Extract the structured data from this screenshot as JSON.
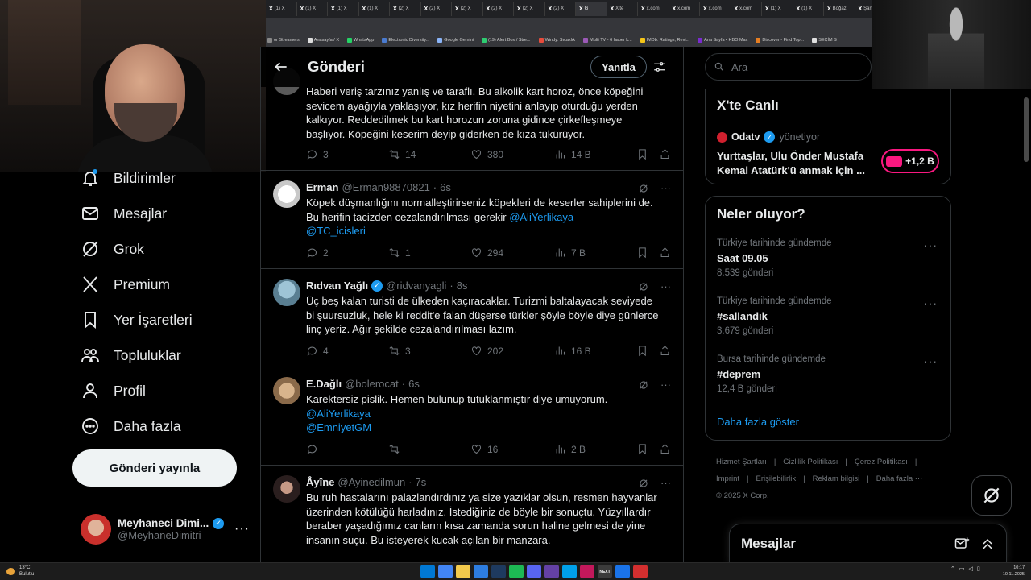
{
  "browser": {
    "tabs": [
      "(1) X",
      "(1) X",
      "(1) X",
      "(1) X",
      "(2) X",
      "(2) X",
      "(2) X",
      "(2) X",
      "(2) X",
      "(2) X",
      "X'te",
      "x.com",
      "x.com",
      "x.com",
      "x.com",
      "(1) X",
      "(1) X",
      "Boğaz",
      "Şan"
    ],
    "active_tab": "G",
    "bookmarks": [
      "or Streamers",
      "Anasayfa / X",
      "WhatsApp",
      "Electronic Diversity...",
      "Google Gemini",
      "(19) Alert Box / Stre...",
      "Windy: Sıcaklık",
      "Multi TV - 6 haber k...",
      "IMDb: Ratings, Revi...",
      "Ana Sayfa • HBO Max",
      "Discover - Find Top...",
      "SEÇİM S"
    ]
  },
  "nav": {
    "items": [
      {
        "label": "Bildirimler",
        "icon": "bell-icon"
      },
      {
        "label": "Mesajlar",
        "icon": "envelope-icon"
      },
      {
        "label": "Grok",
        "icon": "grok-icon"
      },
      {
        "label": "Premium",
        "icon": "x-logo-icon"
      },
      {
        "label": "Yer İşaretleri",
        "icon": "bookmark-icon"
      },
      {
        "label": "Topluluklar",
        "icon": "people-icon"
      },
      {
        "label": "Profil",
        "icon": "person-icon"
      },
      {
        "label": "Daha fazla",
        "icon": "more-circle-icon"
      }
    ],
    "post_button": "Gönderi yayınla",
    "account": {
      "name": "Meyhaneci Dimi...",
      "handle": "@MeyhaneDimitri"
    }
  },
  "header": {
    "title": "Gönderi",
    "reply_button": "Yanıtla"
  },
  "tweets": [
    {
      "name": "",
      "handle": "",
      "time": "",
      "lines": [
        "Haberi veriş tarzınız yanlış ve taraflı. Bu alkolik kart horoz, önce köpeğini",
        "sevicem ayağıyla yaklaşıyor, kız herifin niyetini anlayıp oturduğu yerden",
        "kalkıyor. Reddedilmek bu kart horozun zoruna gidince çirkefleşmeye",
        "başlıyor. Köpeğini keserim deyip giderken de kıza tükürüyor."
      ],
      "mentions": [],
      "replies": "3",
      "reposts": "14",
      "likes": "380",
      "views": "14 B"
    },
    {
      "name": "Erman",
      "handle": "@Erman98870821",
      "time": "6s",
      "lines": [
        "Köpek düşmanlığını normalleştirirseniz köpekleri de keserler sahiplerini de.",
        "Bu herifin tacizden cezalandırılması gerekir"
      ],
      "inline_mention": "@AliYerlikaya",
      "mentions": [
        "@TC_icisleri"
      ],
      "replies": "2",
      "reposts": "1",
      "likes": "294",
      "views": "7 B"
    },
    {
      "name": "Rıdvan Yağlı",
      "handle": "@ridvanyagli",
      "time": "8s",
      "verified": true,
      "lines": [
        "Üç beş kalan turisti de ülkeden kaçıracaklar. Turizmi baltalayacak seviyede",
        "bi şuursuzluk, hele ki reddit'e falan düşerse türkler şöyle böyle diye günlerce",
        "linç yeriz. Ağır şekilde cezalandırılması lazım."
      ],
      "mentions": [],
      "replies": "4",
      "reposts": "3",
      "likes": "202",
      "views": "16 B"
    },
    {
      "name": "E.Dağlı",
      "handle": "@bolerocat",
      "time": "6s",
      "lines": [
        "Karektersiz pislik. Hemen bulunup tutuklanmıştır diye umuyorum."
      ],
      "mentions": [
        "@AliYerlikaya",
        "@EmniyetGM"
      ],
      "replies": "",
      "reposts": "",
      "likes": "16",
      "views": "2 B"
    },
    {
      "name": "Âyîne",
      "handle": "@Ayinedilmun",
      "time": "7s",
      "lines": [
        "Bu ruh hastalarını palazlandırdınız ya size yazıklar olsun, resmen hayvanlar",
        "üzerinden kötülüğü harladınız. İstediğiniz de böyle bir sonuçtu. Yüzyıllardır",
        "beraber yaşadığımız canların kısa zamanda sorun haline gelmesi de yine",
        "insanın suçu. Bu isteyerek kucak açılan bir manzara."
      ],
      "mentions": []
    }
  ],
  "search": {
    "placeholder": "Ara"
  },
  "live": {
    "title": "X'te Canlı",
    "account": "Odatv",
    "role": "yönetiyor",
    "text": "Yurttaşlar, Ulu Önder Mustafa Kemal Atatürk'ü anmak için ...",
    "count": "+1,2 B"
  },
  "trends": {
    "title": "Neler oluyor?",
    "items": [
      {
        "context": "Türkiye tarihinde gündemde",
        "name": "Saat 09.05",
        "count": "8.539 gönderi"
      },
      {
        "context": "Türkiye tarihinde gündemde",
        "name": "#sallandık",
        "count": "3.679 gönderi"
      },
      {
        "context": "Bursa tarihinde gündemde",
        "name": "#deprem",
        "count": "12,4 B gönderi"
      }
    ],
    "show_more": "Daha fazla göster"
  },
  "footer": {
    "links": [
      "Hizmet Şartları",
      "|",
      "Gizlilik Politikası",
      "|",
      "Çerez Politikası",
      "|",
      "Imprint",
      "|",
      "Erişilebilirlik",
      "|",
      "Reklam bilgisi",
      "|",
      "Daha fazla ···",
      "© 2025 X Corp."
    ]
  },
  "messages_drawer": {
    "title": "Mesajlar"
  },
  "taskbar": {
    "weather_temp": "13°C",
    "weather_desc": "Bulutlu",
    "time": "10:17",
    "date": "10.11.2025",
    "app_icons": [
      "",
      "",
      "",
      "",
      "",
      "",
      "",
      "",
      "",
      "",
      "NEXT",
      "",
      ""
    ]
  },
  "colors": {
    "accent": "#1d9bf0",
    "background": "#000000",
    "muted": "#71767b",
    "border": "#2f3336",
    "live_pink": "#f91880"
  }
}
